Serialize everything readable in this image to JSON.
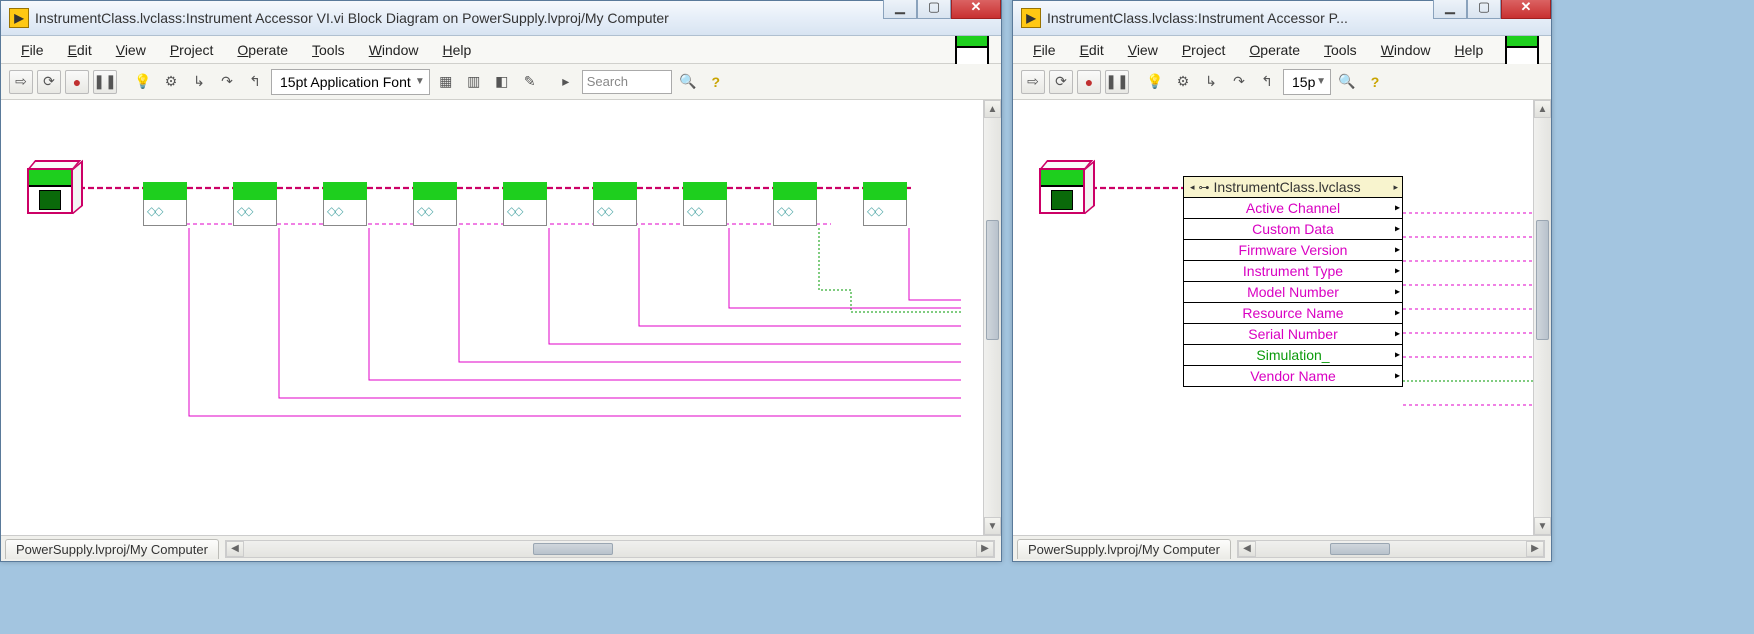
{
  "window_left": {
    "title": "InstrumentClass.lvclass:Instrument Accessor VI.vi Block Diagram on PowerSupply.lvproj/My Computer",
    "status_path": "PowerSupply.lvproj/My Computer"
  },
  "window_right": {
    "title": "InstrumentClass.lvclass:Instrument Accessor P...",
    "status_path": "PowerSupply.lvproj/My Computer"
  },
  "menu": {
    "file": "File",
    "edit": "Edit",
    "view": "View",
    "project": "Project",
    "operate": "Operate",
    "tools": "Tools",
    "window": "Window",
    "help": "Help"
  },
  "toolbar": {
    "font_label": "15pt Application Font",
    "font_label_short": "15p",
    "search_placeholder": "Search"
  },
  "property_node": {
    "class_name": "InstrumentClass.lvclass",
    "rows": [
      {
        "label": "Active Channel",
        "style": "pink"
      },
      {
        "label": "Custom Data",
        "style": "pink"
      },
      {
        "label": "Firmware Version",
        "style": "pink"
      },
      {
        "label": "Instrument Type",
        "style": "pink"
      },
      {
        "label": "Model Number",
        "style": "pink"
      },
      {
        "label": "Resource Name",
        "style": "pink"
      },
      {
        "label": "Serial Number",
        "style": "pink"
      },
      {
        "label": "Simulation_",
        "style": "green"
      },
      {
        "label": "Vendor Name",
        "style": "pink"
      }
    ]
  },
  "subvi_count": 9
}
